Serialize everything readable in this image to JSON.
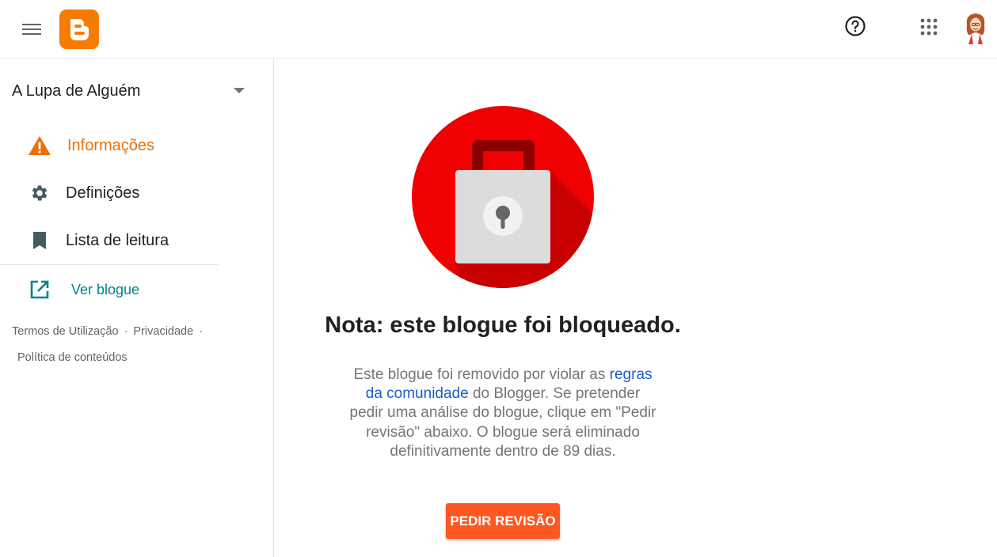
{
  "header": {
    "menu_icon": "hamburger-menu-icon",
    "logo_icon": "blogger-logo-icon",
    "logo_color": "#f57c00",
    "help_icon": "help-circle-icon",
    "apps_icon": "apps-grid-icon",
    "avatar_icon": "user-avatar"
  },
  "sidebar": {
    "blog_name": "A Lupa de Alguém",
    "items": [
      {
        "label": "Informações",
        "icon": "warning-icon",
        "active": true
      },
      {
        "label": "Definições",
        "icon": "gear-icon",
        "active": false
      },
      {
        "label": "Lista de leitura",
        "icon": "bookmark-icon",
        "active": false
      }
    ],
    "view_blog": {
      "label": "Ver blogue",
      "icon": "open-in-new-icon"
    },
    "footer": {
      "terms": "Termos de Utilização",
      "separator": "·",
      "privacy": "Privacidade",
      "content_policy": "Política de conteúdos"
    }
  },
  "main": {
    "illustration_icon": "padlock-icon",
    "title": "Nota: este blogue foi bloqueado.",
    "body_before_link": "Este blogue foi removido por violar as",
    "link_text": "regras da comunidade",
    "body_after_link": "do Blogger. Se pretender pedir uma análise do blogue, clique em \"Pedir revisão\" abaixo. O blogue será eliminado definitivamente dentro de 89 dias.",
    "button_label": "PEDIR REVISÃO"
  },
  "colors": {
    "accent_orange": "#e8710a",
    "button": "#ff5722",
    "link": "#1a5ec8",
    "teal": "#00838f",
    "lock_red": "#f00000"
  }
}
